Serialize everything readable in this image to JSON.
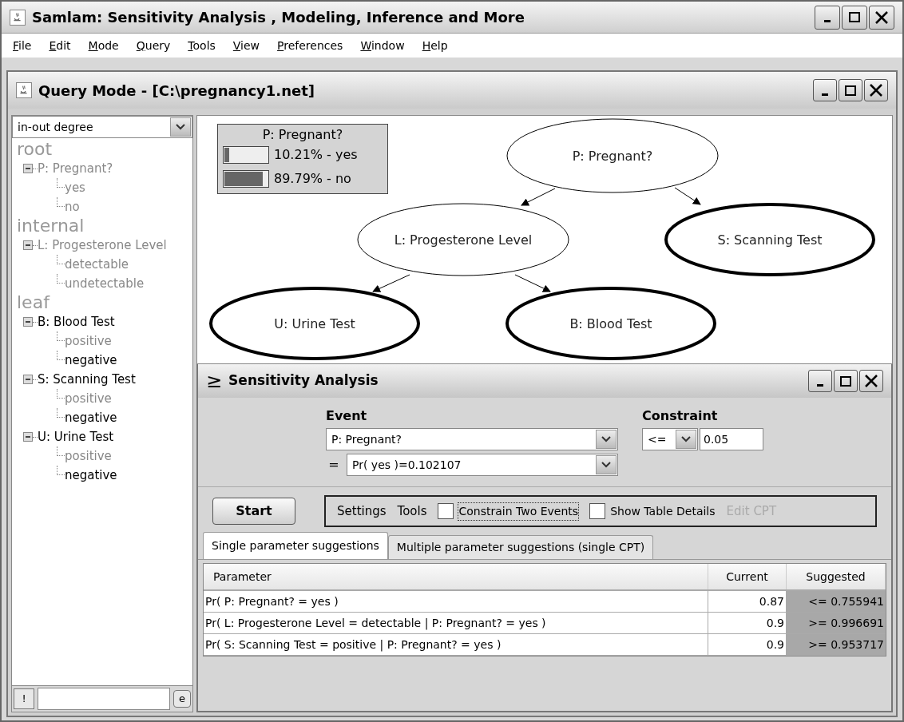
{
  "window": {
    "title": "Samlam: Sensitivity Analysis , Modeling, Inference and More"
  },
  "menu": [
    "File",
    "Edit",
    "Mode",
    "Query",
    "Tools",
    "View",
    "Preferences",
    "Window",
    "Help"
  ],
  "query_window": {
    "title": "Query Mode - [C:\\pregnancy1.net]"
  },
  "sidebar": {
    "sort_select": "in-out degree",
    "groups": [
      {
        "label": "root",
        "nodes": [
          {
            "label": "P: Pregnant?",
            "expanded": true,
            "highlighted": false,
            "children": [
              {
                "label": "yes",
                "highlighted": false
              },
              {
                "label": "no",
                "highlighted": false
              }
            ]
          }
        ]
      },
      {
        "label": "internal",
        "nodes": [
          {
            "label": "L: Progesterone Level",
            "expanded": true,
            "highlighted": false,
            "children": [
              {
                "label": "detectable",
                "highlighted": false
              },
              {
                "label": "undetectable",
                "highlighted": false
              }
            ]
          }
        ]
      },
      {
        "label": "leaf",
        "nodes": [
          {
            "label": "B: Blood Test",
            "expanded": true,
            "highlighted": true,
            "children": [
              {
                "label": "positive",
                "highlighted": false
              },
              {
                "label": "negative",
                "highlighted": true
              }
            ]
          },
          {
            "label": "S: Scanning Test",
            "expanded": true,
            "highlighted": true,
            "children": [
              {
                "label": "positive",
                "highlighted": false
              },
              {
                "label": "negative",
                "highlighted": true
              }
            ]
          },
          {
            "label": "U: Urine Test",
            "expanded": true,
            "highlighted": true,
            "children": [
              {
                "label": "positive",
                "highlighted": false
              },
              {
                "label": "negative",
                "highlighted": true
              }
            ]
          }
        ]
      }
    ],
    "footer_buttons": [
      "!",
      "e"
    ]
  },
  "network": {
    "monitor": {
      "title": "P: Pregnant?",
      "rows": [
        {
          "label": "10.21% - yes",
          "level": 0.1021
        },
        {
          "label": "89.79% - no",
          "level": 0.8979
        }
      ]
    },
    "nodes": [
      {
        "label": "P: Pregnant?",
        "emphasized": false
      },
      {
        "label": "L: Progesterone Level",
        "emphasized": false
      },
      {
        "label": "S: Scanning Test",
        "emphasized": true
      },
      {
        "label": "U: Urine Test",
        "emphasized": true
      },
      {
        "label": "B: Blood Test",
        "emphasized": true
      }
    ]
  },
  "sensitivity": {
    "title": "Sensitivity Analysis",
    "title_symbol": "≥",
    "event_label": "Event",
    "event_select": "P: Pregnant?",
    "equals": "=",
    "value_select": "Pr( yes )=0.102107",
    "constraint_label": "Constraint",
    "constraint_op": "<=",
    "constraint_value": "0.05",
    "start_button": "Start",
    "toolbar": [
      {
        "kind": "menu",
        "label": "Settings"
      },
      {
        "kind": "menu",
        "label": "Tools"
      },
      {
        "kind": "checkbox",
        "label": "Constrain Two Events",
        "checked": false,
        "focused": true
      },
      {
        "kind": "checkbox",
        "label": "Show Table Details",
        "checked": false,
        "focused": false
      },
      {
        "kind": "action",
        "label": "Edit CPT",
        "disabled": true
      }
    ],
    "tabs": [
      {
        "label": "Single parameter suggestions",
        "selected": true
      },
      {
        "label": "Multiple parameter suggestions (single CPT)",
        "selected": false
      }
    ],
    "table": {
      "columns": [
        "Parameter",
        "Current",
        "Suggested"
      ],
      "rows": [
        {
          "parameter": "Pr( P: Pregnant? = yes )",
          "current": "0.87",
          "suggested": "<= 0.755941"
        },
        {
          "parameter": "Pr( L: Progesterone Level = detectable | P: Pregnant? = yes )",
          "current": "0.9",
          "suggested": ">= 0.996691"
        },
        {
          "parameter": "Pr( S: Scanning Test = positive | P: Pregnant? = yes )",
          "current": "0.9",
          "suggested": ">= 0.953717"
        }
      ]
    }
  }
}
